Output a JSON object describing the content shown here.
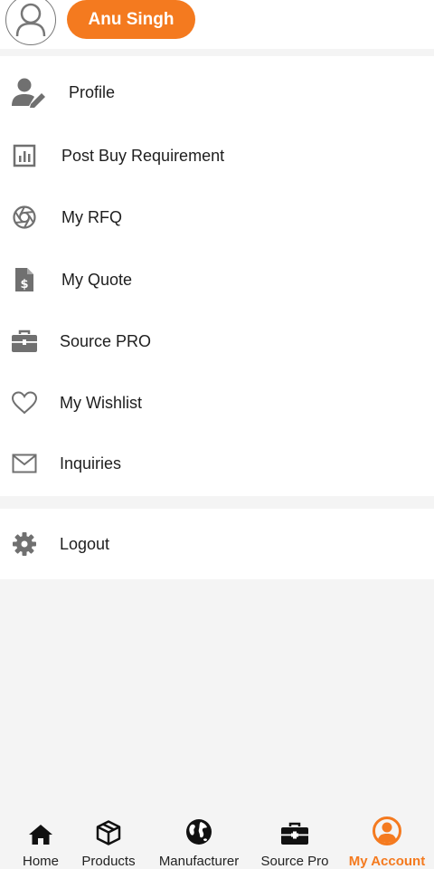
{
  "header": {
    "user_name": "Anu Singh",
    "accent_color": "#f47a1f"
  },
  "menu": {
    "items": [
      {
        "label": "Profile",
        "icon": "user-edit-icon"
      },
      {
        "label": "Post Buy Requirement",
        "icon": "chart-icon"
      },
      {
        "label": "My RFQ",
        "icon": "aperture-icon"
      },
      {
        "label": "My Quote",
        "icon": "document-dollar-icon"
      },
      {
        "label": "Source PRO",
        "icon": "briefcase-icon"
      },
      {
        "label": "My Wishlist",
        "icon": "heart-icon"
      },
      {
        "label": "Inquiries",
        "icon": "envelope-icon"
      }
    ],
    "logout": {
      "label": "Logout",
      "icon": "gear-icon"
    }
  },
  "bottom_nav": {
    "items": [
      {
        "label": "Home",
        "icon": "home-icon"
      },
      {
        "label": "Products",
        "icon": "box-icon"
      },
      {
        "label": "Manufacturer",
        "icon": "globe-icon"
      },
      {
        "label": "Source Pro",
        "icon": "briefcase-icon"
      },
      {
        "label": "My Account",
        "icon": "account-icon"
      }
    ],
    "active": "My Account"
  }
}
